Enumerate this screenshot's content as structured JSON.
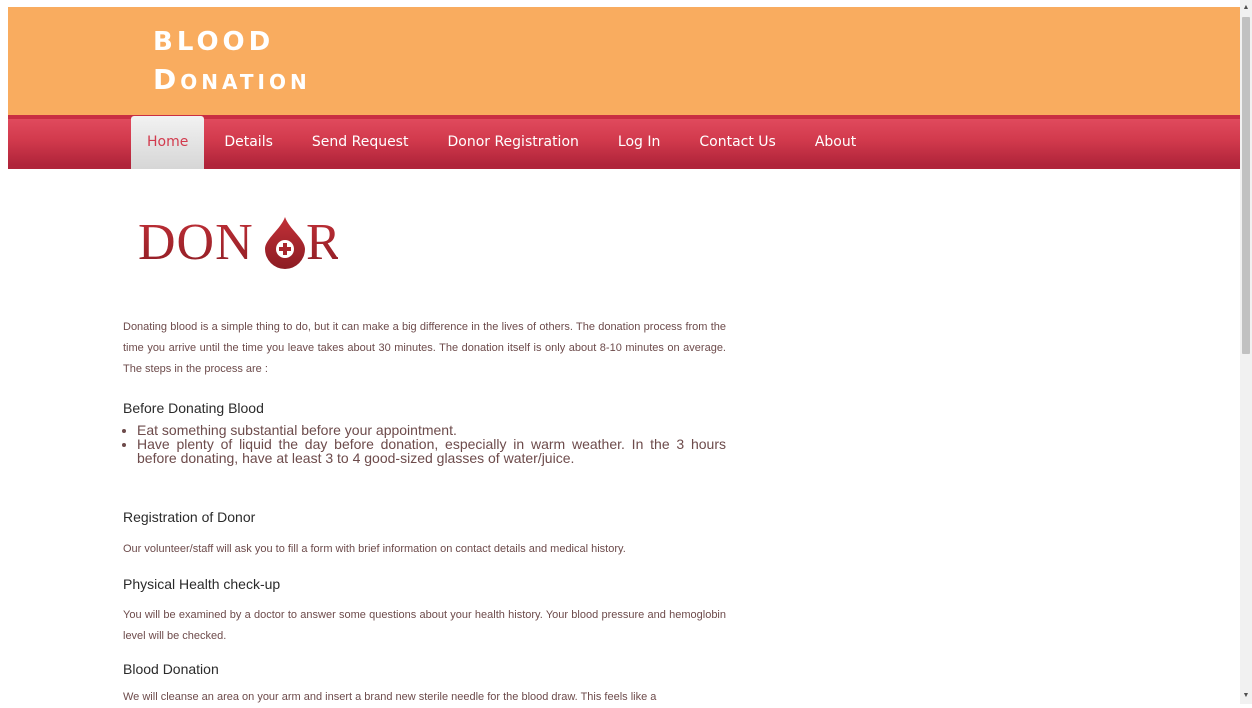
{
  "site": {
    "title_line1": "BLOOD",
    "title_line2": "Donation"
  },
  "nav": {
    "items": [
      "Home",
      "Details",
      "Send Request",
      "Donor Registration",
      "Log In",
      "Contact Us",
      "About"
    ],
    "active": "Home"
  },
  "logo": {
    "text": "DONOR"
  },
  "intro": "Donating blood is a simple thing to do, but it can make a big difference in the lives of others. The donation process from the time you arrive until the time you leave takes about 30 minutes. The donation itself is only about 8-10 minutes on average. The steps in the process are :",
  "sections": {
    "before": {
      "title": "Before Donating Blood",
      "bullets": [
        "Eat something substantial before your appointment.",
        "Have plenty of liquid the day before donation, especially in warm weather. In the 3 hours before donating, have at least 3 to 4 good-sized glasses of water/juice."
      ]
    },
    "registration": {
      "title": "Registration of Donor",
      "text": "Our volunteer/staff will ask you to fill a form with brief information on contact details and medical history."
    },
    "checkup": {
      "title": "Physical Health check-up",
      "text": "You will be examined by a doctor to answer some questions about your health history. Your blood pressure and hemoglobin level will be checked."
    },
    "donation": {
      "title": "Blood Donation",
      "text": "We will cleanse an area on your arm and insert a brand new sterile needle for the blood draw. This feels like a"
    }
  },
  "colors": {
    "header": "#f9ac5f",
    "nav": "#d23a4d",
    "logo": "#a8262d",
    "text": "#6d4b4b"
  }
}
